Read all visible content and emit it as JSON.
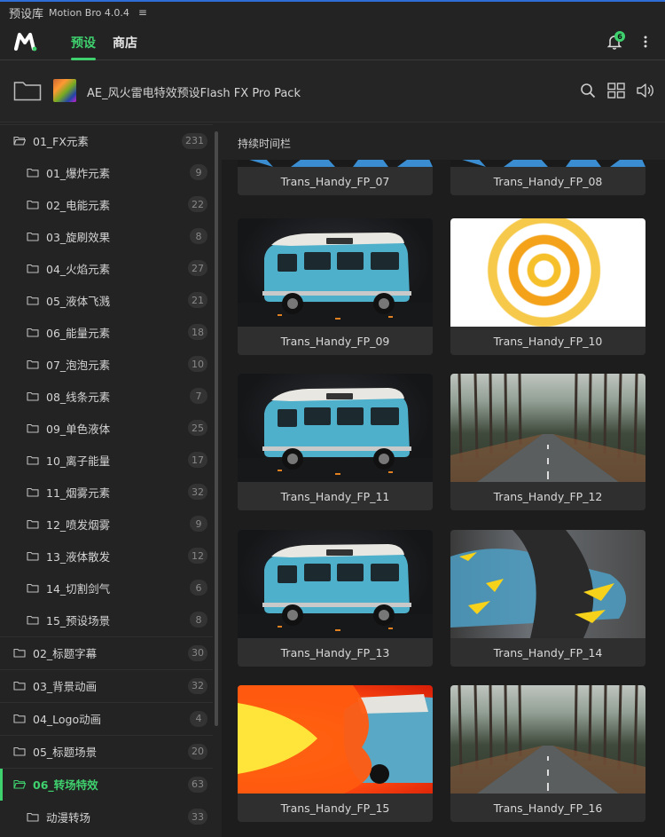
{
  "app": {
    "title": "预设库",
    "subtitle": "Motion Bro 4.0.4",
    "menu_glyph": "≡"
  },
  "nav": {
    "tabs": [
      {
        "label": "预设",
        "active": true
      },
      {
        "label": "商店",
        "active": false
      }
    ],
    "notification_count": "6",
    "accent": "#3fd16e"
  },
  "pack": {
    "title": "AE_风火雷电特效预设Flash FX Pro Pack"
  },
  "sidebar": {
    "items": [
      {
        "label": "01_FX元素",
        "count": "231",
        "level": 0,
        "open": true
      },
      {
        "label": "01_爆炸元素",
        "count": "9",
        "level": 1
      },
      {
        "label": "02_电能元素",
        "count": "22",
        "level": 1
      },
      {
        "label": "03_旋刷效果",
        "count": "8",
        "level": 1
      },
      {
        "label": "04_火焰元素",
        "count": "27",
        "level": 1
      },
      {
        "label": "05_液体飞溅",
        "count": "21",
        "level": 1
      },
      {
        "label": "06_能量元素",
        "count": "18",
        "level": 1
      },
      {
        "label": "07_泡泡元素",
        "count": "10",
        "level": 1
      },
      {
        "label": "08_线条元素",
        "count": "7",
        "level": 1
      },
      {
        "label": "09_单色液体",
        "count": "25",
        "level": 1
      },
      {
        "label": "10_离子能量",
        "count": "17",
        "level": 1
      },
      {
        "label": "11_烟雾元素",
        "count": "32",
        "level": 1
      },
      {
        "label": "12_喷发烟雾",
        "count": "9",
        "level": 1
      },
      {
        "label": "13_液体散发",
        "count": "12",
        "level": 1
      },
      {
        "label": "14_切割剑气",
        "count": "6",
        "level": 1
      },
      {
        "label": "15_预设场景",
        "count": "8",
        "level": 1
      },
      {
        "label": "02_标题字幕",
        "count": "30",
        "level": 0
      },
      {
        "label": "03_背景动画",
        "count": "32",
        "level": 0
      },
      {
        "label": "04_Logo动画",
        "count": "4",
        "level": 0
      },
      {
        "label": "05_标题场景",
        "count": "20",
        "level": 0
      },
      {
        "label": "06_转场特效",
        "count": "63",
        "level": 0,
        "selected": true,
        "open": true
      },
      {
        "label": "动漫转场",
        "count": "33",
        "level": 1
      }
    ]
  },
  "content": {
    "header": "持续时间栏",
    "cards": [
      {
        "name": "Trans_Handy_FP_07",
        "style": "ice"
      },
      {
        "name": "Trans_Handy_FP_08",
        "style": "ice"
      },
      {
        "name": "Trans_Handy_FP_09",
        "style": "van"
      },
      {
        "name": "Trans_Handy_FP_10",
        "style": "tunnel"
      },
      {
        "name": "Trans_Handy_FP_11",
        "style": "van"
      },
      {
        "name": "Trans_Handy_FP_12",
        "style": "road"
      },
      {
        "name": "Trans_Handy_FP_13",
        "style": "van"
      },
      {
        "name": "Trans_Handy_FP_14",
        "style": "blur"
      },
      {
        "name": "Trans_Handy_FP_15",
        "style": "fire"
      },
      {
        "name": "Trans_Handy_FP_16",
        "style": "road"
      }
    ]
  }
}
